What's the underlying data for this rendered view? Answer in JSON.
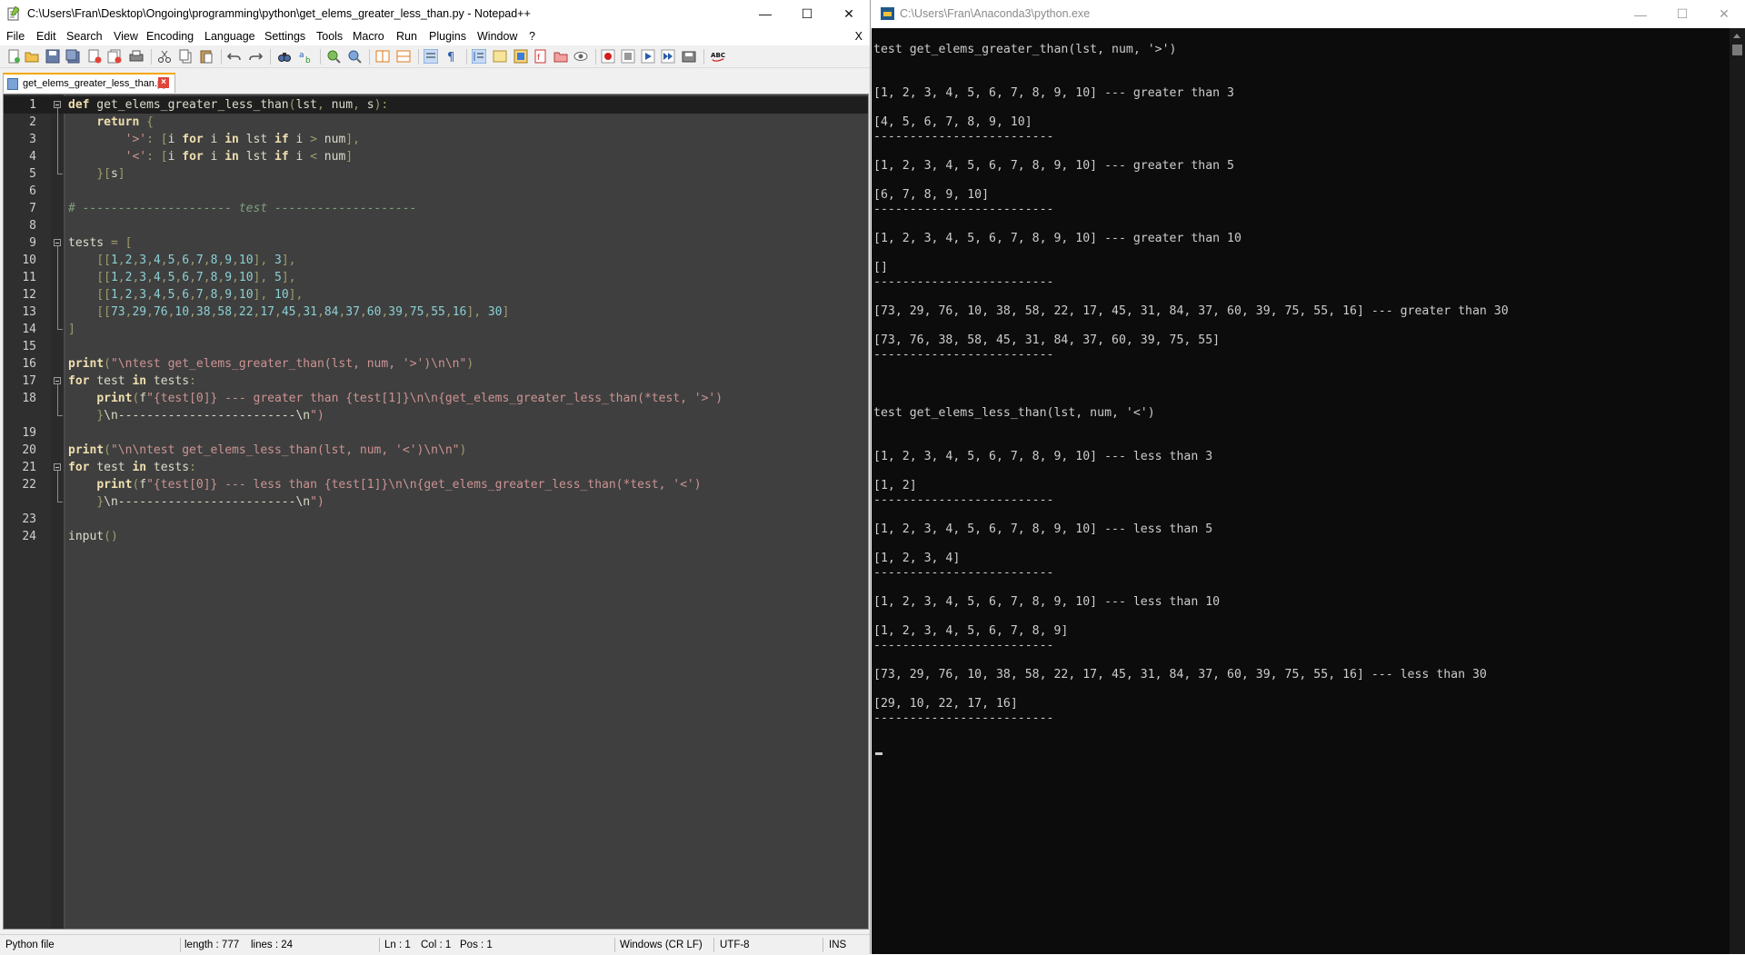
{
  "npp": {
    "title": "C:\\Users\\Fran\\Desktop\\Ongoing\\programming\\python\\get_elems_greater_less_than.py - Notepad++",
    "menu": [
      "File",
      "Edit",
      "Search",
      "View",
      "Encoding",
      "Language",
      "Settings",
      "Tools",
      "Macro",
      "Run",
      "Plugins",
      "Window",
      "?"
    ],
    "menu_close": "X",
    "tab_label": "get_elems_greater_less_than.py",
    "line_numbers": [
      "1",
      "2",
      "3",
      "4",
      "5",
      "6",
      "7",
      "8",
      "9",
      "10",
      "11",
      "12",
      "13",
      "14",
      "15",
      "16",
      "17",
      "18",
      "19",
      "20",
      "21",
      "22",
      "23",
      "24"
    ],
    "code_lines": [
      "def get_elems_greater_less_than(lst, num, s):",
      "    return {",
      "        '>': [i for i in lst if i > num],",
      "        '<': [i for i in lst if i < num]",
      "    }[s]",
      "",
      "# --------------------- test --------------------",
      "",
      "tests = [",
      "    [[1,2,3,4,5,6,7,8,9,10], 3],",
      "    [[1,2,3,4,5,6,7,8,9,10], 5],",
      "    [[1,2,3,4,5,6,7,8,9,10], 10],",
      "    [[73,29,76,10,38,58,22,17,45,31,84,37,60,39,75,55,16], 30]",
      "]",
      "",
      "print(\"\\ntest get_elems_greater_than(lst, num, '>')\\n\\n\")",
      "for test in tests:",
      "    print(f\"{test[0]} --- greater than {test[1]}\\n\\n{get_elems_greater_less_than(*test, '>')",
      "    }\\n-------------------------\\n\")",
      "",
      "print(\"\\n\\ntest get_elems_less_than(lst, num, '<')\\n\\n\")",
      "for test in tests:",
      "    print(f\"{test[0]} --- less than {test[1]}\\n\\n{get_elems_greater_less_than(*test, '<')",
      "    }\\n-------------------------\\n\")",
      "",
      "input()"
    ],
    "status": {
      "file_type": "Python file",
      "length": "length : 777",
      "lines": "lines : 24",
      "ln": "Ln : 1",
      "col": "Col : 1",
      "pos": "Pos : 1",
      "eol": "Windows (CR LF)",
      "encoding": "UTF-8",
      "mode": "INS"
    }
  },
  "console": {
    "title": "C:\\Users\\Fran\\Anaconda3\\python.exe",
    "lines": [
      "test get_elems_greater_than(lst, num, '>')",
      "[1, 2, 3, 4, 5, 6, 7, 8, 9, 10] --- greater than 3",
      "[4, 5, 6, 7, 8, 9, 10]",
      "-------------------------",
      "[1, 2, 3, 4, 5, 6, 7, 8, 9, 10] --- greater than 5",
      "[6, 7, 8, 9, 10]",
      "-------------------------",
      "[1, 2, 3, 4, 5, 6, 7, 8, 9, 10] --- greater than 10",
      "[]",
      "-------------------------",
      "[73, 29, 76, 10, 38, 58, 22, 17, 45, 31, 84, 37, 60, 39, 75, 55, 16] --- greater than 30",
      "[73, 76, 38, 58, 45, 31, 84, 37, 60, 39, 75, 55]",
      "-------------------------",
      "test get_elems_less_than(lst, num, '<')",
      "[1, 2, 3, 4, 5, 6, 7, 8, 9, 10] --- less than 3",
      "[1, 2]",
      "-------------------------",
      "[1, 2, 3, 4, 5, 6, 7, 8, 9, 10] --- less than 5",
      "[1, 2, 3, 4]",
      "-------------------------",
      "[1, 2, 3, 4, 5, 6, 7, 8, 9, 10] --- less than 10",
      "[1, 2, 3, 4, 5, 6, 7, 8, 9]",
      "-------------------------",
      "[73, 29, 76, 10, 38, 58, 22, 17, 45, 31, 84, 37, 60, 39, 75, 55, 16] --- less than 30",
      "[29, 10, 22, 17, 16]",
      "-------------------------"
    ]
  },
  "colors": {
    "editor_bg": "#3f3f3f",
    "console_bg": "#0c0c0c",
    "tab_accent": "#f5a700"
  }
}
